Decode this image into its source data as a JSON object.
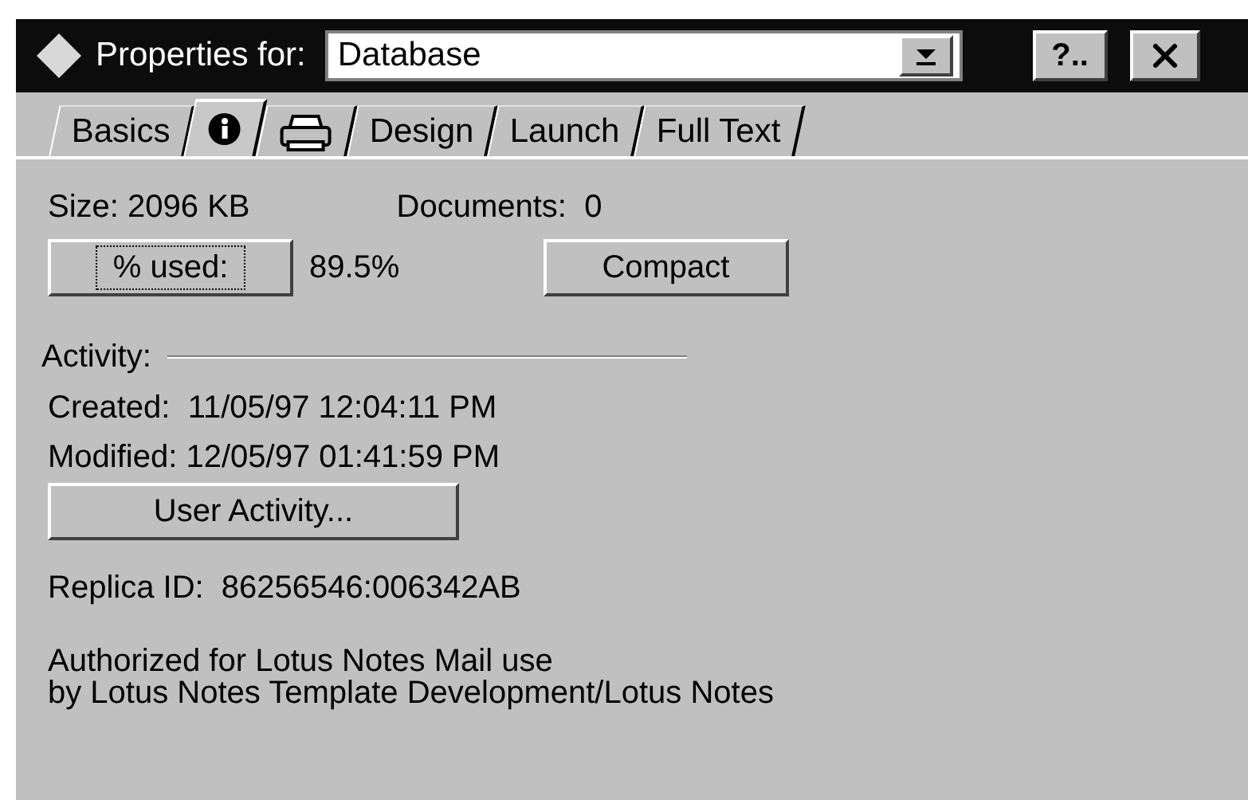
{
  "title_bar": {
    "label": "Properties for:",
    "dropdown": {
      "value": "Database"
    },
    "help_button": "?.."
  },
  "tabs": [
    {
      "kind": "text",
      "label": "Basics",
      "selected": false
    },
    {
      "kind": "info",
      "selected": true
    },
    {
      "kind": "printer",
      "selected": false
    },
    {
      "kind": "text",
      "label": "Design",
      "selected": false
    },
    {
      "kind": "text",
      "label": "Launch",
      "selected": false
    },
    {
      "kind": "text",
      "label": "Full Text",
      "selected": false
    }
  ],
  "info": {
    "size": "Size: 2096 KB",
    "documents": "Documents:  0",
    "percent_button": {
      "label": "% used:",
      "focused": true
    },
    "percent_value": "89.5%",
    "compact_button": "Compact",
    "activity_heading": "Activity:",
    "created": "Created:  11/05/97 12:04:11 PM",
    "modified": "Modified: 12/05/97 01:41:59 PM",
    "user_activity_button": "User Activity...",
    "replica_id": "Replica ID:  86256546:006342AB",
    "description": [
      "Authorized for Lotus Notes Mail use",
      "by Lotus Notes Template Development/Lotus Notes"
    ]
  }
}
